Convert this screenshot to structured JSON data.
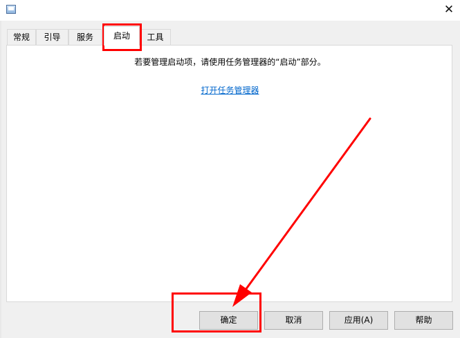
{
  "window": {
    "close_glyph": "✕"
  },
  "tabs": [
    {
      "label": "常规"
    },
    {
      "label": "引导"
    },
    {
      "label": "服务"
    },
    {
      "label": "启动"
    },
    {
      "label": "工具"
    }
  ],
  "startup_panel": {
    "message": "若要管理启动项，请使用任务管理器的“启动”部分。",
    "link_label": "打开任务管理器"
  },
  "buttons": {
    "ok": "确定",
    "cancel": "取消",
    "apply": "应用(A)",
    "help": "帮助"
  },
  "annotations": {
    "highlight_color": "#ff0000"
  }
}
